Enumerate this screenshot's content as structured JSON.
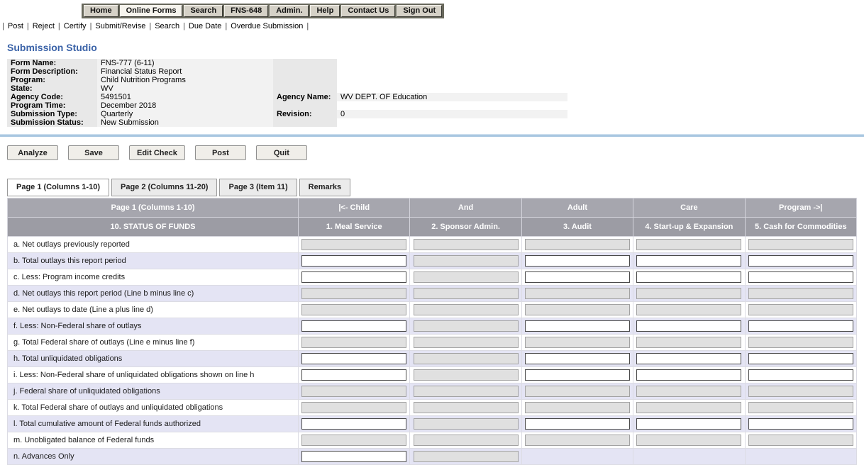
{
  "nav": {
    "items": [
      {
        "label": "Home",
        "active": false
      },
      {
        "label": "Online Forms",
        "active": true
      },
      {
        "label": "Search",
        "active": false
      },
      {
        "label": "FNS-648",
        "active": false
      },
      {
        "label": "Admin.",
        "active": false
      },
      {
        "label": "Help",
        "active": false
      },
      {
        "label": "Contact Us",
        "active": false
      },
      {
        "label": "Sign Out",
        "active": false
      }
    ]
  },
  "toolbar": {
    "links": [
      "Post",
      "Reject",
      "Certify",
      "Submit/Revise",
      "Search",
      "Due Date",
      "Overdue Submission"
    ]
  },
  "page": {
    "title": "Submission Studio"
  },
  "form_info": {
    "rows": [
      {
        "label": "Form Name:",
        "value": "FNS-777 (6-11)"
      },
      {
        "label": "Form Description:",
        "value": "Financial Status Report"
      },
      {
        "label": "Program:",
        "value": "Child Nutrition Programs"
      },
      {
        "label": "State:",
        "value": "WV"
      },
      {
        "label": "Agency Code:",
        "value": "5491501",
        "label2": "Agency Name:",
        "value2": "WV DEPT. OF Education"
      },
      {
        "label": "Program Time:",
        "value": "December 2018"
      },
      {
        "label": "Submission Type:",
        "value": "Quarterly",
        "label2": "Revision:",
        "value2": "0"
      },
      {
        "label": "Submission Status:",
        "value": "New Submission"
      }
    ]
  },
  "actions": [
    "Analyze",
    "Save",
    "Edit Check",
    "Post",
    "Quit"
  ],
  "tabs": [
    {
      "label": "Page 1 (Columns 1-10)",
      "active": true
    },
    {
      "label": "Page 2 (Columns 11-20)",
      "active": false
    },
    {
      "label": "Page 3 (Item 11)",
      "active": false
    },
    {
      "label": "Remarks",
      "active": false
    }
  ],
  "grid": {
    "header_row1": [
      "Page 1 (Columns 1-10)",
      "|<- Child",
      "And",
      "Adult",
      "Care",
      "Program ->|"
    ],
    "header_row2": [
      "10. STATUS OF FUNDS",
      "1. Meal Service",
      "2. Sponsor Admin.",
      "3. Audit",
      "4. Start-up & Expansion",
      "5. Cash for Commodities"
    ],
    "rows": [
      {
        "label": "a. Net outlays previously reported",
        "cells": [
          "disabled",
          "disabled",
          "disabled",
          "disabled",
          "disabled"
        ]
      },
      {
        "label": "b. Total outlays this report period",
        "cells": [
          "input",
          "disabled",
          "input",
          "input",
          "input"
        ]
      },
      {
        "label": "c. Less: Program income credits",
        "cells": [
          "input",
          "disabled",
          "input",
          "input",
          "input"
        ]
      },
      {
        "label": "d. Net outlays this report period (Line b minus line c)",
        "cells": [
          "disabled",
          "disabled",
          "disabled",
          "disabled",
          "disabled"
        ]
      },
      {
        "label": "e. Net outlays to date (Line a plus line d)",
        "cells": [
          "disabled",
          "disabled",
          "disabled",
          "disabled",
          "disabled"
        ]
      },
      {
        "label": "f. Less: Non-Federal share of outlays",
        "cells": [
          "input",
          "disabled",
          "input",
          "input",
          "input"
        ]
      },
      {
        "label": "g. Total Federal share of outlays (Line e minus line f)",
        "cells": [
          "disabled",
          "disabled",
          "disabled",
          "disabled",
          "disabled"
        ]
      },
      {
        "label": "h. Total unliquidated obligations",
        "cells": [
          "input",
          "disabled",
          "input",
          "input",
          "input"
        ]
      },
      {
        "label": "i. Less: Non-Federal share of unliquidated obligations shown on line h",
        "cells": [
          "input",
          "disabled",
          "input",
          "input",
          "input"
        ]
      },
      {
        "label": "j. Federal share of unliquidated obligations",
        "cells": [
          "disabled",
          "disabled",
          "disabled",
          "disabled",
          "disabled"
        ]
      },
      {
        "label": "k. Total Federal share of outlays and unliquidated obligations",
        "cells": [
          "disabled",
          "disabled",
          "disabled",
          "disabled",
          "disabled"
        ]
      },
      {
        "label": "l. Total cumulative amount of Federal funds authorized",
        "cells": [
          "input",
          "disabled",
          "input",
          "input",
          "input"
        ]
      },
      {
        "label": "m. Unobligated balance of Federal funds",
        "cells": [
          "disabled",
          "disabled",
          "disabled",
          "disabled",
          "disabled"
        ]
      },
      {
        "label": "n. Advances Only",
        "cells": [
          "input",
          "disabled",
          "none",
          "none",
          "none"
        ]
      }
    ],
    "field_values": ""
  },
  "colors": {
    "nav_bar_bg": "#68685c",
    "nav_btn_bg": "#d5d1c7",
    "nav_btn_active_bg": "#f6f4ee",
    "title_blue": "#3b63a8",
    "info_label_bg": "#e8e8e8",
    "info_value_bg": "#f2f2f2",
    "divider_blue": "#a9c7e1",
    "table_header_bg": "#a6a6ae",
    "table_header2_bg": "#9c9ca4",
    "row_alt_bg": "#e4e4f4",
    "disabled_field_bg": "#e0e0e0"
  }
}
